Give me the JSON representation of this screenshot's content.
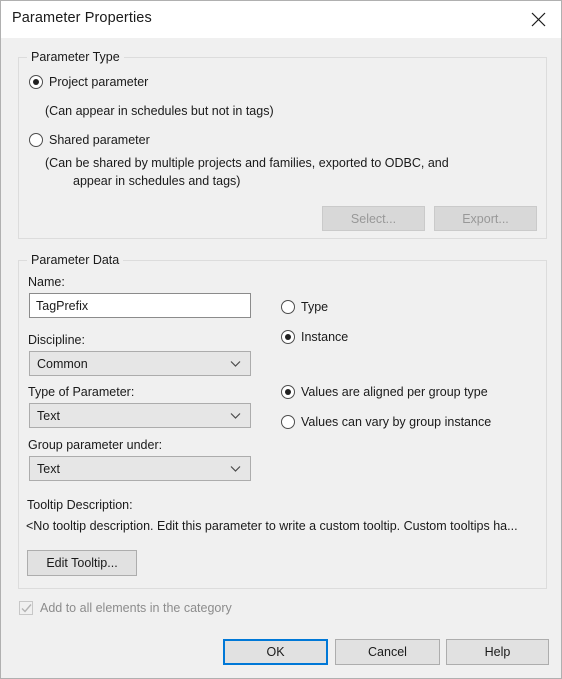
{
  "dialog": {
    "title": "Parameter Properties",
    "close_icon": "close-icon"
  },
  "parameter_type": {
    "legend": "Parameter Type",
    "options": [
      {
        "label": "Project parameter",
        "selected": true,
        "hint": "(Can appear in schedules but not in tags)"
      },
      {
        "label": "Shared parameter",
        "selected": false,
        "hint_line1": "(Can be shared by multiple projects and families, exported to ODBC, and",
        "hint_line2": "appear in schedules and tags)"
      }
    ],
    "select_button": "Select...",
    "export_button": "Export..."
  },
  "parameter_data": {
    "legend": "Parameter Data",
    "name_label": "Name:",
    "name_value": "TagPrefix",
    "name_placeholder": "",
    "discipline_label": "Discipline:",
    "discipline_value": "Common",
    "type_of_parameter_label": "Type of Parameter:",
    "type_of_parameter_value": "Text",
    "group_parameter_under_label": "Group parameter under:",
    "group_parameter_under_value": "Text",
    "binding_options": [
      {
        "label": "Type",
        "selected": false
      },
      {
        "label": "Instance",
        "selected": true
      }
    ],
    "group_value_options": [
      {
        "label": "Values are aligned per group type",
        "selected": true
      },
      {
        "label": "Values can vary by group instance",
        "selected": false
      }
    ],
    "tooltip_label": "Tooltip Description:",
    "tooltip_value": "<No tooltip description. Edit this parameter to write a custom tooltip. Custom tooltips ha...",
    "edit_tooltip_button": "Edit Tooltip..."
  },
  "footer": {
    "add_to_all_label": "Add to all elements in the category",
    "add_to_all_checked": true,
    "add_to_all_disabled": true,
    "ok_button": "OK",
    "cancel_button": "Cancel",
    "help_button": "Help"
  },
  "colors": {
    "accent_focus": "#0078d7",
    "dialog_background": "#f0f0f0",
    "titlebar_background": "#ffffff",
    "button_face": "#e1e1e1",
    "disabled_text": "#989898"
  }
}
